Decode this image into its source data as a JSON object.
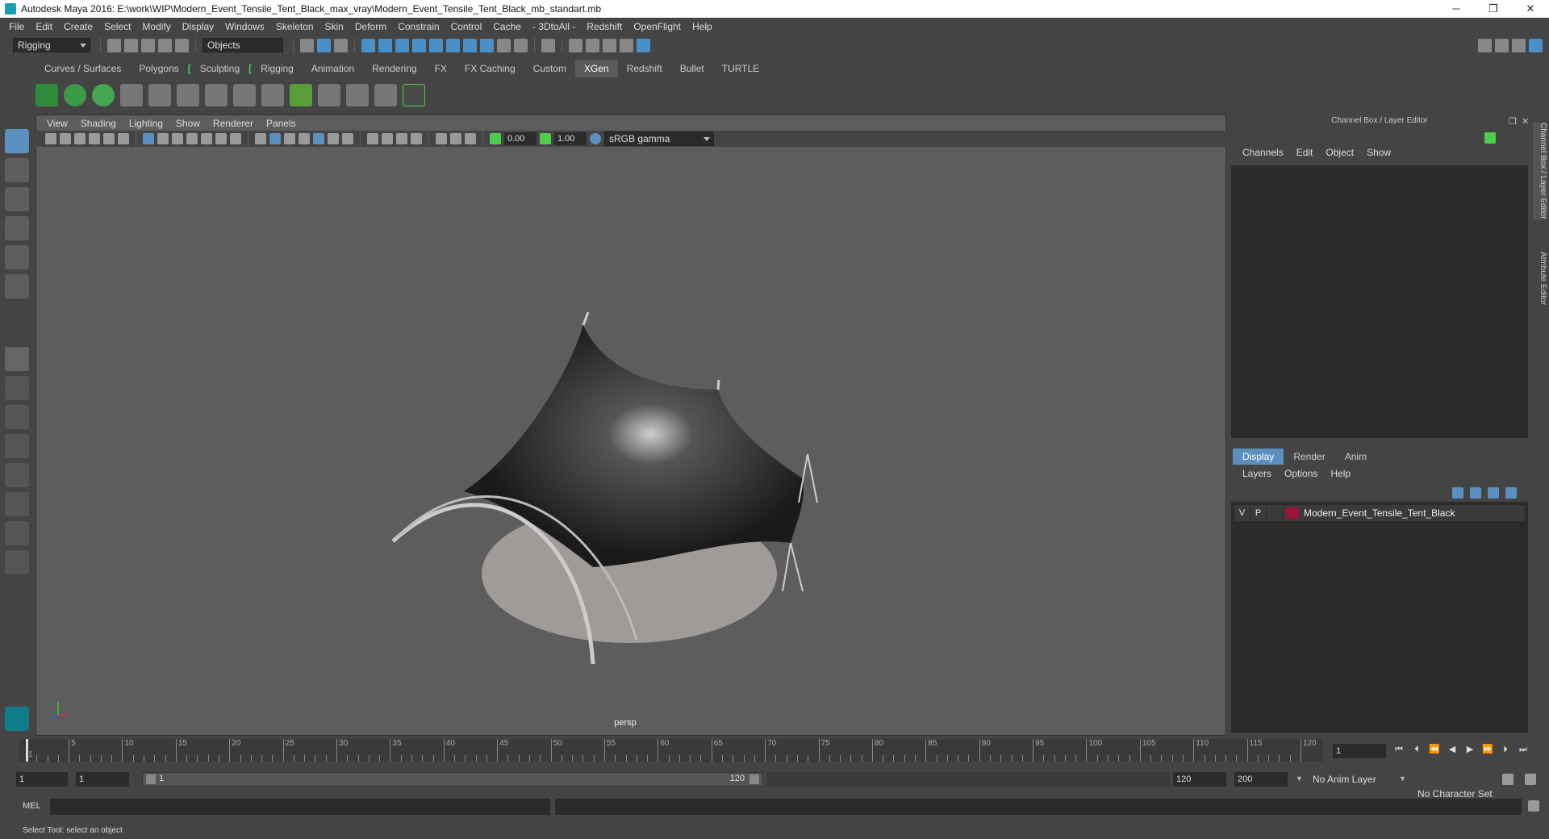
{
  "window": {
    "title": "Autodesk Maya 2016: E:\\work\\WIP\\Modern_Event_Tensile_Tent_Black_max_vray\\Modern_Event_Tensile_Tent_Black_mb_standart.mb",
    "minimize": "─",
    "restore": "❐",
    "close": "✕"
  },
  "menubar": [
    "File",
    "Edit",
    "Create",
    "Select",
    "Modify",
    "Display",
    "Windows",
    "Skeleton",
    "Skin",
    "Deform",
    "Constrain",
    "Control",
    "Cache",
    "- 3DtoAll -",
    "Redshift",
    "OpenFlight",
    "Help"
  ],
  "statusline": {
    "mode": "Rigging",
    "selection_mode": "Objects"
  },
  "shelf": {
    "tabs": [
      "Curves / Surfaces",
      "Polygons",
      "Sculpting",
      "Rigging",
      "Animation",
      "Rendering",
      "FX",
      "FX Caching",
      "Custom",
      "XGen",
      "Redshift",
      "Bullet",
      "TURTLE"
    ],
    "active_tab": "XGen"
  },
  "viewport": {
    "menu": [
      "View",
      "Shading",
      "Lighting",
      "Show",
      "Renderer",
      "Panels"
    ],
    "exposure": "0.00",
    "gamma": "1.00",
    "color_space": "sRGB gamma",
    "camera": "persp"
  },
  "channel_box": {
    "title": "Channel Box / Layer Editor",
    "menu": [
      "Channels",
      "Edit",
      "Object",
      "Show"
    ]
  },
  "layer_editor": {
    "tabs": [
      "Display",
      "Render",
      "Anim"
    ],
    "active_tab": "Display",
    "menu": [
      "Layers",
      "Options",
      "Help"
    ],
    "layers": [
      {
        "v": "V",
        "p": "P",
        "name": "Modern_Event_Tensile_Tent_Black",
        "color": "#9a1636"
      }
    ]
  },
  "side_tabs": {
    "channel": "Channel Box / Layer Editor",
    "attribute": "Attribute Editor"
  },
  "timeline": {
    "ticks": [
      "1",
      "5",
      "10",
      "15",
      "20",
      "25",
      "30",
      "35",
      "40",
      "45",
      "50",
      "55",
      "60",
      "65",
      "70",
      "75",
      "80",
      "85",
      "90",
      "95",
      "100",
      "105",
      "110",
      "115",
      "120"
    ],
    "current_frame": "1"
  },
  "range": {
    "start": "1",
    "playback_start": "1",
    "slider_start": "1",
    "slider_end": "120",
    "playback_end": "120",
    "end": "200",
    "anim_layer": "No Anim Layer",
    "character_set": "No Character Set"
  },
  "command": {
    "label": "MEL"
  },
  "help_line": "Select Tool: select an object"
}
